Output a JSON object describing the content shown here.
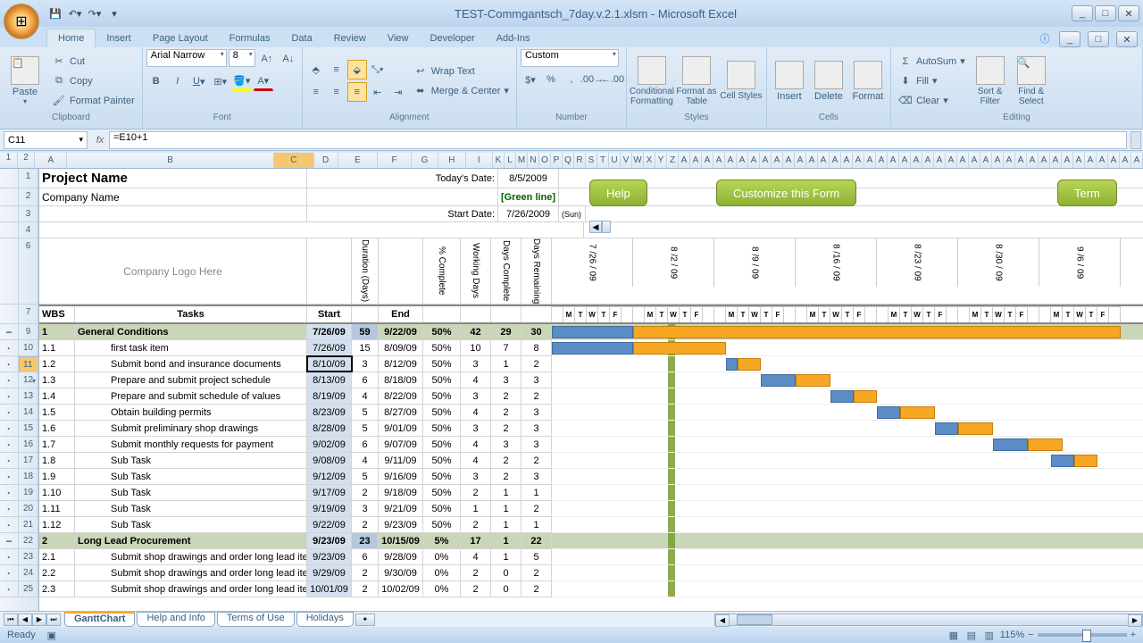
{
  "title": "TEST-Commgantsch_7day.v.2.1.xlsm - Microsoft Excel",
  "ribbon_tabs": [
    "Home",
    "Insert",
    "Page Layout",
    "Formulas",
    "Data",
    "Review",
    "View",
    "Developer",
    "Add-Ins"
  ],
  "clipboard": {
    "paste": "Paste",
    "cut": "Cut",
    "copy": "Copy",
    "format_painter": "Format Painter",
    "label": "Clipboard"
  },
  "font": {
    "name": "Arial Narrow",
    "size": "8",
    "label": "Font"
  },
  "alignment": {
    "wrap": "Wrap Text",
    "merge": "Merge & Center",
    "label": "Alignment"
  },
  "number": {
    "format": "Custom",
    "label": "Number"
  },
  "styles": {
    "conditional": "Conditional Formatting",
    "ftable": "Format as Table",
    "cellstyles": "Cell Styles",
    "label": "Styles"
  },
  "cells": {
    "insert": "Insert",
    "delete": "Delete",
    "format": "Format",
    "label": "Cells"
  },
  "editing": {
    "autosum": "AutoSum",
    "fill": "Fill",
    "clear": "Clear",
    "sort": "Sort & Filter",
    "find": "Find & Select",
    "label": "Editing"
  },
  "name_box": "C11",
  "formula": "=E10+1",
  "cols_left": [
    "A",
    "B",
    "C",
    "D",
    "E",
    "F",
    "G",
    "H",
    "I"
  ],
  "cols_right_letters": [
    "K",
    "L",
    "M",
    "N",
    "O",
    "P",
    "Q",
    "R",
    "S",
    "T",
    "U",
    "V",
    "W",
    "X",
    "Y",
    "Z"
  ],
  "header": {
    "project": "Project Name",
    "company": "Company Name",
    "logo": "Company Logo Here",
    "today_lbl": "Today's Date:",
    "today": "8/5/2009",
    "green": "[Green line]",
    "start_lbl": "Start Date:",
    "start": "7/26/2009",
    "start_day": "(Sun)"
  },
  "buttons": {
    "help": "Help",
    "customize": "Customize this Form",
    "term": "Term"
  },
  "col_hdrs": {
    "wbs": "WBS",
    "tasks": "Tasks",
    "start": "Start",
    "duration": "Duration (Days)",
    "end": "End",
    "pct": "% Complete",
    "workdays": "Working Days",
    "dayscomp": "Days Complete",
    "daysrem": "Days Remaining"
  },
  "weeks": [
    "7 /26 / 09",
    "8 /2 / 09",
    "8 /9 / 09",
    "8 /16 / 09",
    "8 /23 / 09",
    "8 /30 / 09",
    "9 /6 / 09"
  ],
  "day_lbls": [
    "M",
    "T",
    "W",
    "T",
    "F"
  ],
  "rows": [
    {
      "n": "9",
      "wbs": "1",
      "task": "General Conditions",
      "start": "7/26/09",
      "dur": "59",
      "end": "9/22/09",
      "pct": "50%",
      "wd": "42",
      "dc": "29",
      "dr": "30",
      "group": true,
      "gantt": {
        "blue": [
          0,
          91
        ],
        "orange": [
          91,
          546
        ]
      }
    },
    {
      "n": "10",
      "wbs": "1.1",
      "task": "first task item",
      "start": "7/26/09",
      "dur": "15",
      "end": "8/09/09",
      "pct": "50%",
      "wd": "10",
      "dc": "7",
      "dr": "8",
      "gantt": {
        "blue": [
          0,
          91
        ],
        "orange": [
          91,
          104
        ]
      }
    },
    {
      "n": "11",
      "wbs": "1.2",
      "task": "Submit bond and insurance documents",
      "start": "8/10/09",
      "dur": "3",
      "end": "8/12/09",
      "pct": "50%",
      "wd": "3",
      "dc": "1",
      "dr": "2",
      "sel": true,
      "gantt": {
        "blue": [
          195,
          13
        ],
        "orange": [
          208,
          26
        ]
      }
    },
    {
      "n": "12",
      "wbs": "1.3",
      "task": "Prepare and submit project schedule",
      "start": "8/13/09",
      "dur": "6",
      "end": "8/18/09",
      "pct": "50%",
      "wd": "4",
      "dc": "3",
      "dr": "3",
      "gantt": {
        "blue": [
          234,
          39
        ],
        "orange": [
          273,
          39
        ]
      }
    },
    {
      "n": "13",
      "wbs": "1.4",
      "task": "Prepare and submit schedule of values",
      "start": "8/19/09",
      "dur": "4",
      "end": "8/22/09",
      "pct": "50%",
      "wd": "3",
      "dc": "2",
      "dr": "2",
      "gantt": {
        "blue": [
          312,
          26
        ],
        "orange": [
          338,
          26
        ]
      }
    },
    {
      "n": "14",
      "wbs": "1.5",
      "task": "Obtain building permits",
      "start": "8/23/09",
      "dur": "5",
      "end": "8/27/09",
      "pct": "50%",
      "wd": "4",
      "dc": "2",
      "dr": "3",
      "gantt": {
        "blue": [
          364,
          26
        ],
        "orange": [
          390,
          39
        ]
      }
    },
    {
      "n": "15",
      "wbs": "1.6",
      "task": "Submit preliminary shop drawings",
      "start": "8/28/09",
      "dur": "5",
      "end": "9/01/09",
      "pct": "50%",
      "wd": "3",
      "dc": "2",
      "dr": "3",
      "gantt": {
        "blue": [
          429,
          26
        ],
        "orange": [
          455,
          39
        ]
      }
    },
    {
      "n": "16",
      "wbs": "1.7",
      "task": "Submit monthly requests for payment",
      "start": "9/02/09",
      "dur": "6",
      "end": "9/07/09",
      "pct": "50%",
      "wd": "4",
      "dc": "3",
      "dr": "3",
      "gantt": {
        "blue": [
          494,
          39
        ],
        "orange": [
          533,
          39
        ]
      }
    },
    {
      "n": "17",
      "wbs": "1.8",
      "task": "Sub Task",
      "start": "9/08/09",
      "dur": "4",
      "end": "9/11/09",
      "pct": "50%",
      "wd": "4",
      "dc": "2",
      "dr": "2",
      "gantt": {
        "blue": [
          559,
          26
        ],
        "orange": [
          585,
          26
        ]
      }
    },
    {
      "n": "18",
      "wbs": "1.9",
      "task": "Sub Task",
      "start": "9/12/09",
      "dur": "5",
      "end": "9/16/09",
      "pct": "50%",
      "wd": "3",
      "dc": "2",
      "dr": "3"
    },
    {
      "n": "19",
      "wbs": "1.10",
      "task": "Sub Task",
      "start": "9/17/09",
      "dur": "2",
      "end": "9/18/09",
      "pct": "50%",
      "wd": "2",
      "dc": "1",
      "dr": "1"
    },
    {
      "n": "20",
      "wbs": "1.11",
      "task": "Sub Task",
      "start": "9/19/09",
      "dur": "3",
      "end": "9/21/09",
      "pct": "50%",
      "wd": "1",
      "dc": "1",
      "dr": "2"
    },
    {
      "n": "21",
      "wbs": "1.12",
      "task": "Sub Task",
      "start": "9/22/09",
      "dur": "2",
      "end": "9/23/09",
      "pct": "50%",
      "wd": "2",
      "dc": "1",
      "dr": "1"
    },
    {
      "n": "22",
      "wbs": "2",
      "task": "Long Lead Procurement",
      "start": "9/23/09",
      "dur": "23",
      "end": "10/15/09",
      "pct": "5%",
      "wd": "17",
      "dc": "1",
      "dr": "22",
      "group": true
    },
    {
      "n": "23",
      "wbs": "2.1",
      "task": "Submit shop drawings and order long lead items - steel",
      "start": "9/23/09",
      "dur": "6",
      "end": "9/28/09",
      "pct": "0%",
      "wd": "4",
      "dc": "1",
      "dr": "5"
    },
    {
      "n": "24",
      "wbs": "2.2",
      "task": "Submit shop drawings and order long lead items - roofing",
      "start": "9/29/09",
      "dur": "2",
      "end": "9/30/09",
      "pct": "0%",
      "wd": "2",
      "dc": "0",
      "dr": "2"
    },
    {
      "n": "25",
      "wbs": "2.3",
      "task": "Submit shop drawings and order long lead items - elevator",
      "start": "10/01/09",
      "dur": "2",
      "end": "10/02/09",
      "pct": "0%",
      "wd": "2",
      "dc": "0",
      "dr": "2"
    }
  ],
  "sheet_tabs": [
    "GanttChart",
    "Help and Info",
    "Terms of Use",
    "Holidays"
  ],
  "status": "Ready",
  "zoom": "115%"
}
